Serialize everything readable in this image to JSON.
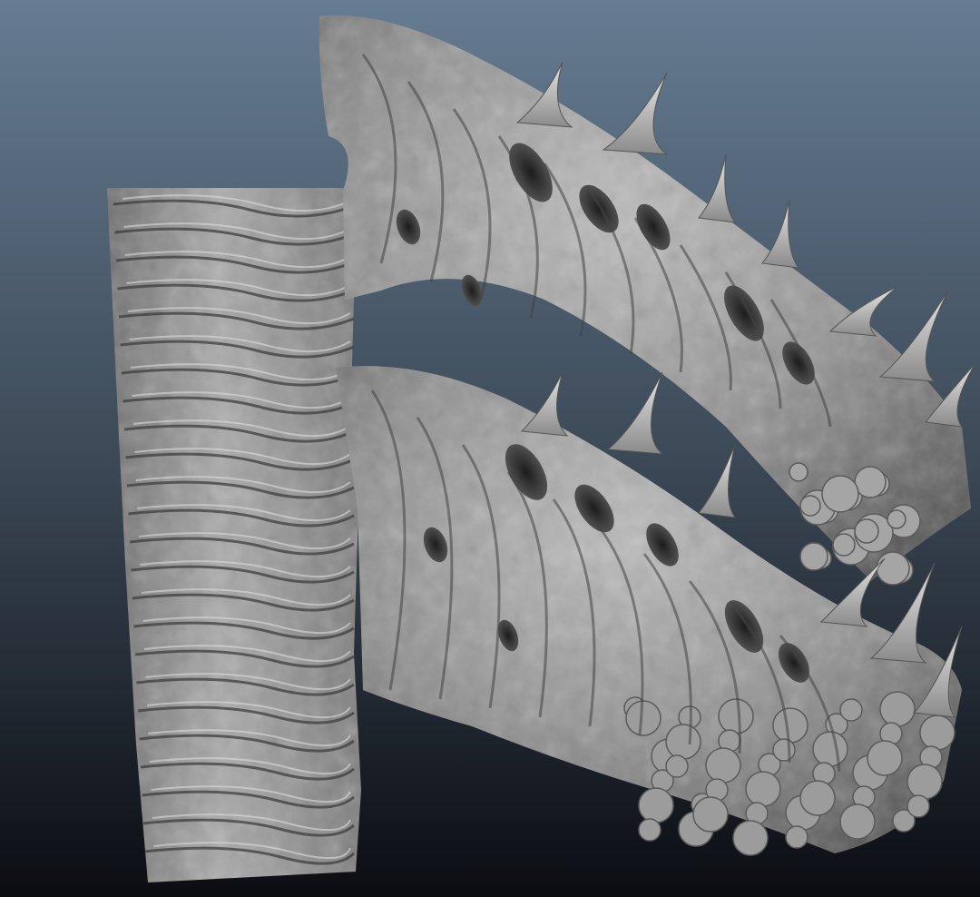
{
  "scene": {
    "background_top": "#667c92",
    "background_mid": "#3d4a58",
    "background_bottom": "#0b0d12",
    "material_light": "#d2d2d2",
    "material_mid": "#8e8e8e",
    "material_dark": "#3a3a3a",
    "subject_icon": "sculpted-biomechanical-spine-icon"
  }
}
